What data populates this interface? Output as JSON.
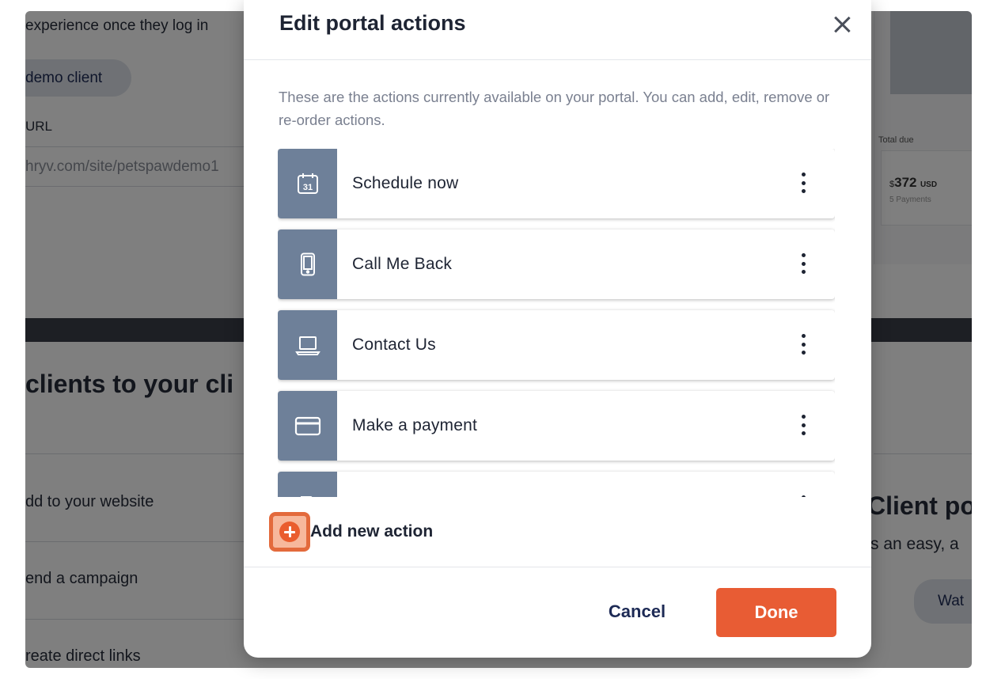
{
  "background": {
    "intro_text": "experience once they log in",
    "demo_client_label": "demo client",
    "url_label": "URL",
    "url_value": "hryv.com/site/petspawdemo1",
    "section_heading": "clients to your cli",
    "items": [
      {
        "label": "dd to your website"
      },
      {
        "label": "end a campaign"
      },
      {
        "label": "reate direct links"
      }
    ],
    "invoice": {
      "total_due_label": "Total due",
      "currency_symbol": "$",
      "amount": "372",
      "currency": "USD",
      "payments": "5 Payments"
    },
    "promo_heading": "Client po",
    "promo_text": "s an easy, a",
    "watch_label": "Wat"
  },
  "modal": {
    "title": "Edit portal actions",
    "description": "These are the actions currently available on your portal. You can add, edit, remove or re-order actions.",
    "actions": [
      {
        "label": "Schedule now",
        "icon": "calendar-icon"
      },
      {
        "label": "Call Me Back",
        "icon": "phone-icon"
      },
      {
        "label": "Contact Us",
        "icon": "laptop-icon"
      },
      {
        "label": "Make a payment",
        "icon": "credit-card-icon"
      },
      {
        "label": "",
        "icon": "document-icon"
      }
    ],
    "add_action_label": "Add new action",
    "cancel_label": "Cancel",
    "done_label": "Done"
  },
  "colors": {
    "accent": "#e85c34",
    "icon_tile": "#6e8099",
    "navy": "#1d2a55"
  }
}
